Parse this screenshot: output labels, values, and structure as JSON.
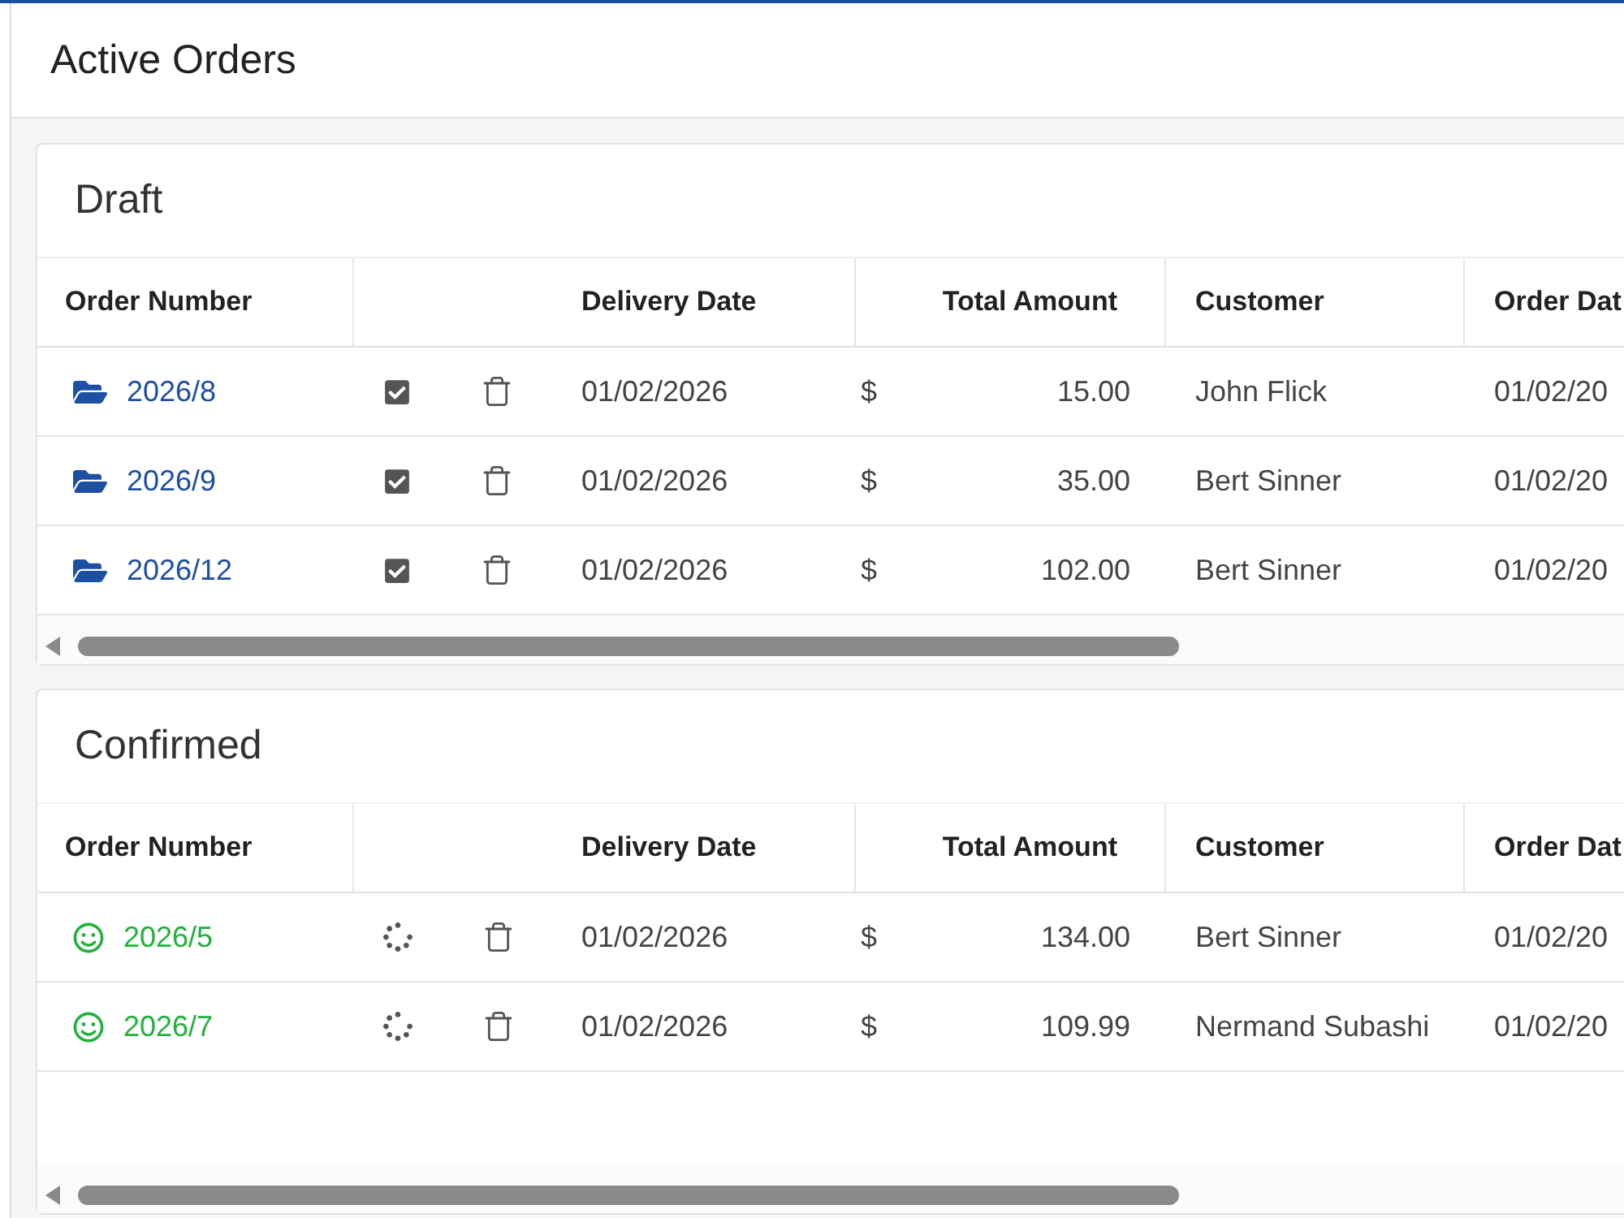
{
  "page": {
    "title": "Active Orders"
  },
  "sections": [
    {
      "title": "Draft",
      "kind": "draft",
      "columns": [
        "Order Number",
        "Delivery Date",
        "Total Amount",
        "Customer",
        "Order Dat"
      ],
      "rows": [
        {
          "order_number": "2026/8",
          "checked": true,
          "delivery_date": "01/02/2026",
          "currency": "$",
          "total_amount": "15.00",
          "customer": "John Flick",
          "order_date": "01/02/20"
        },
        {
          "order_number": "2026/9",
          "checked": true,
          "delivery_date": "01/02/2026",
          "currency": "$",
          "total_amount": "35.00",
          "customer": "Bert Sinner",
          "order_date": "01/02/20"
        },
        {
          "order_number": "2026/12",
          "checked": true,
          "delivery_date": "01/02/2026",
          "currency": "$",
          "total_amount": "102.00",
          "customer": "Bert Sinner",
          "order_date": "01/02/20"
        }
      ]
    },
    {
      "title": "Confirmed",
      "kind": "confirmed",
      "columns": [
        "Order Number",
        "Delivery Date",
        "Total Amount",
        "Customer",
        "Order Dat"
      ],
      "rows": [
        {
          "order_number": "2026/5",
          "delivery_date": "01/02/2026",
          "currency": "$",
          "total_amount": "134.00",
          "customer": "Bert Sinner",
          "order_date": "01/02/20"
        },
        {
          "order_number": "2026/7",
          "delivery_date": "01/02/2026",
          "currency": "$",
          "total_amount": "109.99",
          "customer": "Nermand Subashi",
          "order_date": "01/02/20"
        }
      ]
    }
  ]
}
